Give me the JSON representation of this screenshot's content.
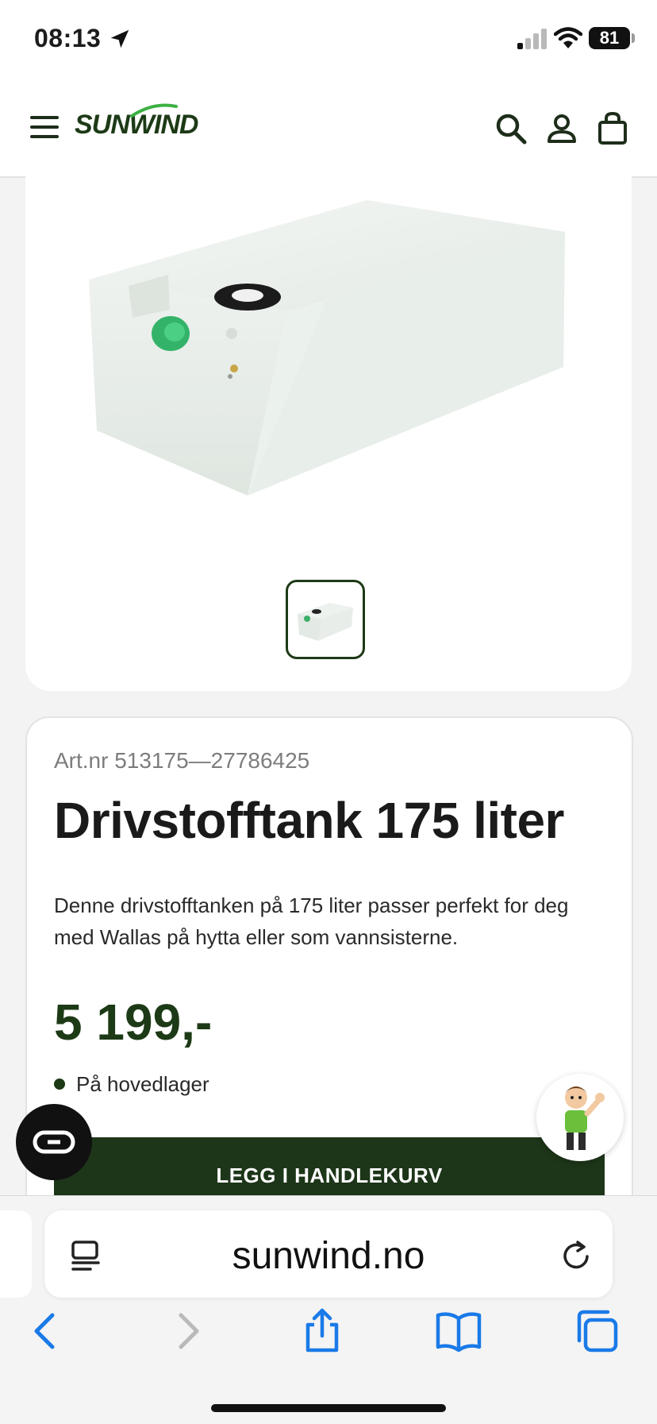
{
  "status_bar": {
    "time": "08:13",
    "battery": "81"
  },
  "site": {
    "logo_text": "SUNWIND"
  },
  "product": {
    "art_nr": "Art.nr 513175—27786425",
    "title": "Drivstofftank 175 liter",
    "description": "Denne drivstofftanken på 175 liter passer perfekt for deg med Wallas på hytta eller som vannsisterne.",
    "price": "5 199,-",
    "stock": "På hovedlager",
    "add_to_cart": "LEGG I HANDLEKURV"
  },
  "browser": {
    "url": "sunwind.no"
  },
  "colors": {
    "brand": "#1d3a16",
    "button": "#1d3518",
    "link_blue": "#1a7ae8"
  },
  "icons": [
    "location-arrow-icon",
    "signal-icon",
    "wifi-icon",
    "battery-icon",
    "menu-icon",
    "search-icon",
    "user-icon",
    "bag-icon",
    "reader-icon",
    "reload-icon",
    "back-icon",
    "forward-icon",
    "share-icon",
    "bookmarks-icon",
    "tabs-icon"
  ]
}
